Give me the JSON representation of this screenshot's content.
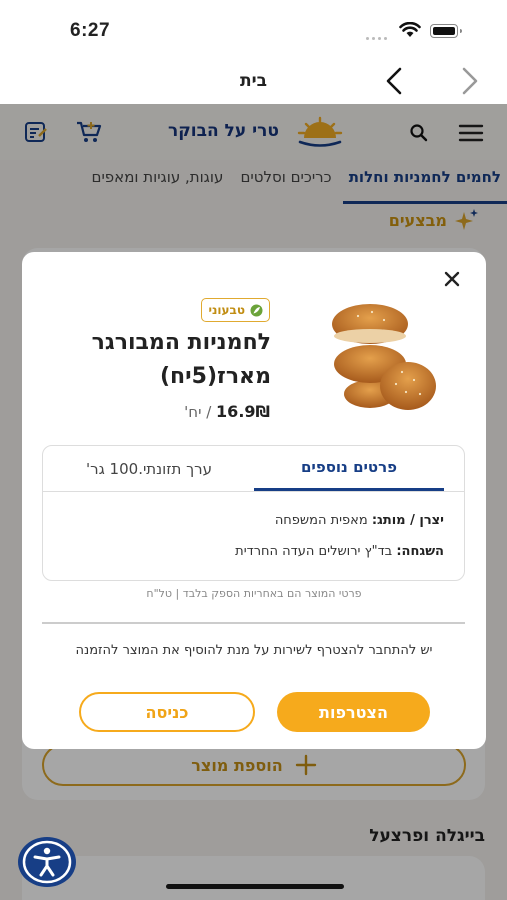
{
  "status_bar": {
    "time": "6:27"
  },
  "nav_bar": {
    "title": "בית"
  },
  "app_header": {
    "logo_text": "טרי על הבוקר"
  },
  "categories": [
    "לחמים לחמניות וחלות",
    "כריכים וסלטים",
    "עוגות, עוגיות ומאפים"
  ],
  "promo": {
    "label": "מבצעים"
  },
  "background": {
    "add_product": "הוספת מוצר",
    "section_title": "בייגלה ופרצעל"
  },
  "modal": {
    "badge": "טבעוני",
    "title": "לחמניות המבורגר מארז(5יח)",
    "price_value": "16.9₪",
    "price_unit": "/ יח'",
    "tabs": [
      "פרטים נוספים",
      "ערך תזונתי.100 גר'"
    ],
    "details": [
      {
        "label": "יצרן / מותג:",
        "value": "מאפית המשפחה"
      },
      {
        "label": "השגחה:",
        "value": "בד\"ץ ירושלים העדה החרדית"
      }
    ],
    "disclaimer": "פרטי המוצר הם באחריות הספק בלבד | טל\"ח",
    "login_note": "יש להתחבר להצטרף לשירות על מנת להוסיף את המוצר להזמנה",
    "join_button": "הצטרפות",
    "login_button": "כניסה"
  },
  "colors": {
    "accent": "#f6aa1c",
    "brand": "#173e86"
  }
}
